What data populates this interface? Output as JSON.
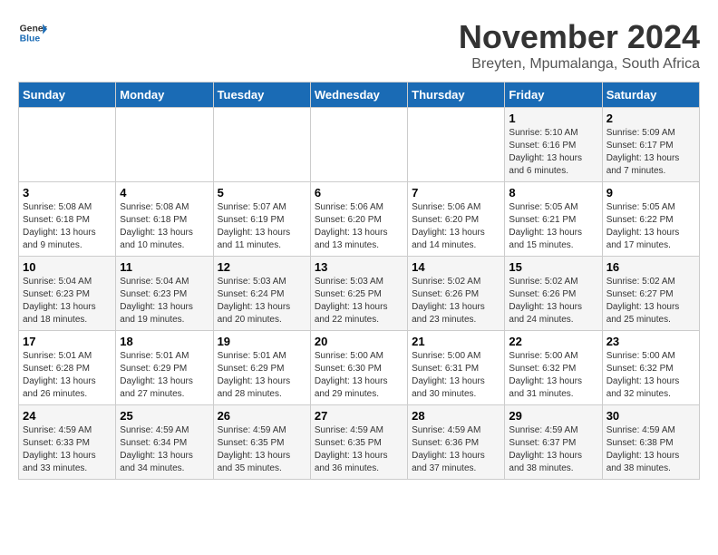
{
  "header": {
    "logo_line1": "General",
    "logo_line2": "Blue",
    "title": "November 2024",
    "subtitle": "Breyten, Mpumalanga, South Africa"
  },
  "days_of_week": [
    "Sunday",
    "Monday",
    "Tuesday",
    "Wednesday",
    "Thursday",
    "Friday",
    "Saturday"
  ],
  "weeks": [
    [
      {
        "day": "",
        "info": ""
      },
      {
        "day": "",
        "info": ""
      },
      {
        "day": "",
        "info": ""
      },
      {
        "day": "",
        "info": ""
      },
      {
        "day": "",
        "info": ""
      },
      {
        "day": "1",
        "info": "Sunrise: 5:10 AM\nSunset: 6:16 PM\nDaylight: 13 hours and 6 minutes."
      },
      {
        "day": "2",
        "info": "Sunrise: 5:09 AM\nSunset: 6:17 PM\nDaylight: 13 hours and 7 minutes."
      }
    ],
    [
      {
        "day": "3",
        "info": "Sunrise: 5:08 AM\nSunset: 6:18 PM\nDaylight: 13 hours and 9 minutes."
      },
      {
        "day": "4",
        "info": "Sunrise: 5:08 AM\nSunset: 6:18 PM\nDaylight: 13 hours and 10 minutes."
      },
      {
        "day": "5",
        "info": "Sunrise: 5:07 AM\nSunset: 6:19 PM\nDaylight: 13 hours and 11 minutes."
      },
      {
        "day": "6",
        "info": "Sunrise: 5:06 AM\nSunset: 6:20 PM\nDaylight: 13 hours and 13 minutes."
      },
      {
        "day": "7",
        "info": "Sunrise: 5:06 AM\nSunset: 6:20 PM\nDaylight: 13 hours and 14 minutes."
      },
      {
        "day": "8",
        "info": "Sunrise: 5:05 AM\nSunset: 6:21 PM\nDaylight: 13 hours and 15 minutes."
      },
      {
        "day": "9",
        "info": "Sunrise: 5:05 AM\nSunset: 6:22 PM\nDaylight: 13 hours and 17 minutes."
      }
    ],
    [
      {
        "day": "10",
        "info": "Sunrise: 5:04 AM\nSunset: 6:23 PM\nDaylight: 13 hours and 18 minutes."
      },
      {
        "day": "11",
        "info": "Sunrise: 5:04 AM\nSunset: 6:23 PM\nDaylight: 13 hours and 19 minutes."
      },
      {
        "day": "12",
        "info": "Sunrise: 5:03 AM\nSunset: 6:24 PM\nDaylight: 13 hours and 20 minutes."
      },
      {
        "day": "13",
        "info": "Sunrise: 5:03 AM\nSunset: 6:25 PM\nDaylight: 13 hours and 22 minutes."
      },
      {
        "day": "14",
        "info": "Sunrise: 5:02 AM\nSunset: 6:26 PM\nDaylight: 13 hours and 23 minutes."
      },
      {
        "day": "15",
        "info": "Sunrise: 5:02 AM\nSunset: 6:26 PM\nDaylight: 13 hours and 24 minutes."
      },
      {
        "day": "16",
        "info": "Sunrise: 5:02 AM\nSunset: 6:27 PM\nDaylight: 13 hours and 25 minutes."
      }
    ],
    [
      {
        "day": "17",
        "info": "Sunrise: 5:01 AM\nSunset: 6:28 PM\nDaylight: 13 hours and 26 minutes."
      },
      {
        "day": "18",
        "info": "Sunrise: 5:01 AM\nSunset: 6:29 PM\nDaylight: 13 hours and 27 minutes."
      },
      {
        "day": "19",
        "info": "Sunrise: 5:01 AM\nSunset: 6:29 PM\nDaylight: 13 hours and 28 minutes."
      },
      {
        "day": "20",
        "info": "Sunrise: 5:00 AM\nSunset: 6:30 PM\nDaylight: 13 hours and 29 minutes."
      },
      {
        "day": "21",
        "info": "Sunrise: 5:00 AM\nSunset: 6:31 PM\nDaylight: 13 hours and 30 minutes."
      },
      {
        "day": "22",
        "info": "Sunrise: 5:00 AM\nSunset: 6:32 PM\nDaylight: 13 hours and 31 minutes."
      },
      {
        "day": "23",
        "info": "Sunrise: 5:00 AM\nSunset: 6:32 PM\nDaylight: 13 hours and 32 minutes."
      }
    ],
    [
      {
        "day": "24",
        "info": "Sunrise: 4:59 AM\nSunset: 6:33 PM\nDaylight: 13 hours and 33 minutes."
      },
      {
        "day": "25",
        "info": "Sunrise: 4:59 AM\nSunset: 6:34 PM\nDaylight: 13 hours and 34 minutes."
      },
      {
        "day": "26",
        "info": "Sunrise: 4:59 AM\nSunset: 6:35 PM\nDaylight: 13 hours and 35 minutes."
      },
      {
        "day": "27",
        "info": "Sunrise: 4:59 AM\nSunset: 6:35 PM\nDaylight: 13 hours and 36 minutes."
      },
      {
        "day": "28",
        "info": "Sunrise: 4:59 AM\nSunset: 6:36 PM\nDaylight: 13 hours and 37 minutes."
      },
      {
        "day": "29",
        "info": "Sunrise: 4:59 AM\nSunset: 6:37 PM\nDaylight: 13 hours and 38 minutes."
      },
      {
        "day": "30",
        "info": "Sunrise: 4:59 AM\nSunset: 6:38 PM\nDaylight: 13 hours and 38 minutes."
      }
    ]
  ]
}
